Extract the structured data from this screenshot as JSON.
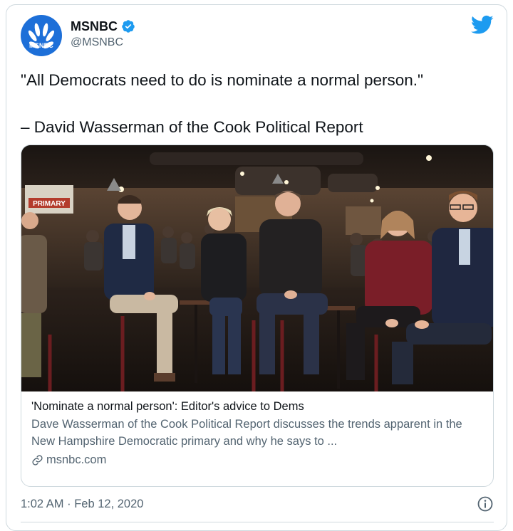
{
  "account": {
    "display_name": "MSNBC",
    "handle": "@MSNBC",
    "avatar_label": "MSNBC",
    "verified": true
  },
  "tweet": {
    "line1": "\"All Democrats need to do is nominate a normal person.\"",
    "line2": "– David Wasserman of the Cook Political Report"
  },
  "card": {
    "image_icon": "tv-panel-photo",
    "title": "'Nominate a normal person': Editor's advice to Dems",
    "description": "Dave Wasserman of the Cook Political Report discusses the trends apparent in the New Hampshire Democratic primary and why he says to ...",
    "domain": "msnbc.com",
    "banner_text": "PRIMARY"
  },
  "footer": {
    "timestamp": "1:02 AM · Feb 12, 2020"
  },
  "colors": {
    "twitter_blue": "#1d9bf0",
    "msnbc_blue": "#1d6fd8",
    "text_primary": "#0f1419",
    "text_secondary": "#536471",
    "border": "#cfd9de"
  },
  "icons": {
    "verified": "verified-badge-icon",
    "brand": "twitter-bird-icon",
    "link": "link-icon",
    "info": "info-icon"
  }
}
